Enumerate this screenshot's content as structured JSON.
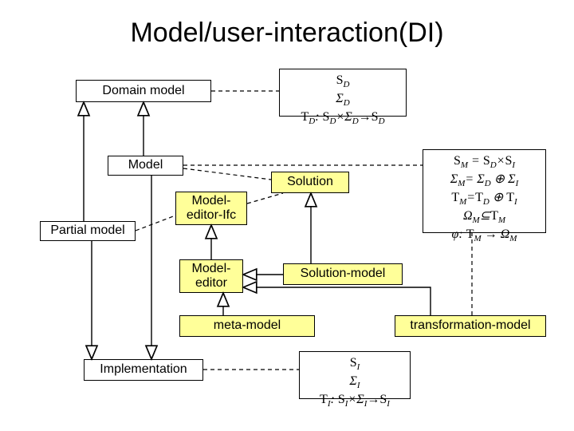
{
  "title": "Model/user-interaction(DI)",
  "boxes": {
    "domain_model": "Domain model",
    "model": "Model",
    "partial_model": "Partial model",
    "solution": "Solution",
    "model_editor_ifc": "Model-\neditor-Ifc",
    "model_editor": "Model-\neditor",
    "solution_model": "Solution-model",
    "meta_model": "meta-model",
    "transformation_model": "transformation-model",
    "implementation": "Implementation"
  },
  "math": {
    "domain": {
      "line1": "S_D",
      "line2": "Σ_D",
      "line3": "T_D: S_D × Σ_D → S_D"
    },
    "model_sm": {
      "line1": "S_M = S_D × S_I",
      "line2": "Σ_M = Σ_D ⊕ Σ_I",
      "line3": "T_M = T_D ⊕ T_I",
      "line4": "Ω_M ⊆ T_M",
      "line5": "φ: T_M → Ω_M"
    },
    "impl": {
      "line1": "S_I",
      "line2": "Σ_I",
      "line3": "T_I: S_I × Σ_I → S_I"
    }
  },
  "chart_data": {
    "type": "diagram",
    "title": "Model/user-interaction(DI)",
    "nodes": [
      {
        "id": "domain_model",
        "label": "Domain model",
        "kind": "class"
      },
      {
        "id": "model",
        "label": "Model",
        "kind": "class"
      },
      {
        "id": "partial_model",
        "label": "Partial model",
        "kind": "class"
      },
      {
        "id": "solution",
        "label": "Solution",
        "kind": "class-yellow"
      },
      {
        "id": "model_editor_ifc",
        "label": "Model-editor-Ifc",
        "kind": "class-yellow"
      },
      {
        "id": "model_editor",
        "label": "Model-editor",
        "kind": "class-yellow"
      },
      {
        "id": "solution_model",
        "label": "Solution-model",
        "kind": "class-yellow"
      },
      {
        "id": "meta_model",
        "label": "meta-model",
        "kind": "class-yellow"
      },
      {
        "id": "transformation_model",
        "label": "transformation-model",
        "kind": "class-yellow"
      },
      {
        "id": "implementation",
        "label": "Implementation",
        "kind": "class"
      },
      {
        "id": "math_domain",
        "label": "S_D; Σ_D; T_D: S_D×Σ_D→S_D",
        "kind": "note"
      },
      {
        "id": "math_model",
        "label": "S_M=S_D×S_I; Σ_M=Σ_D⊕Σ_I; T_M=T_D⊕T_I; Ω_M⊆T_M; φ:T_M→Ω_M",
        "kind": "note"
      },
      {
        "id": "math_impl",
        "label": "S_I; Σ_I; T_I: S_I×Σ_I→S_I",
        "kind": "note"
      }
    ],
    "edges": [
      {
        "from": "model",
        "to": "domain_model",
        "type": "generalization"
      },
      {
        "from": "partial_model",
        "to": "domain_model",
        "type": "generalization"
      },
      {
        "from": "model",
        "to": "implementation",
        "type": "generalization"
      },
      {
        "from": "partial_model",
        "to": "implementation",
        "type": "generalization"
      },
      {
        "from": "model_editor",
        "to": "model_editor_ifc",
        "type": "generalization"
      },
      {
        "from": "solution_model",
        "to": "solution",
        "type": "generalization"
      },
      {
        "from": "solution_model",
        "to": "model_editor",
        "type": "generalization"
      },
      {
        "from": "meta_model",
        "to": "model_editor",
        "type": "generalization"
      },
      {
        "from": "transformation_model",
        "to": "model_editor",
        "type": "generalization"
      },
      {
        "from": "domain_model",
        "to": "math_domain",
        "type": "note-anchor"
      },
      {
        "from": "model",
        "to": "math_model",
        "type": "note-anchor"
      },
      {
        "from": "model",
        "to": "solution",
        "type": "note-anchor"
      },
      {
        "from": "model_editor_ifc",
        "to": "solution",
        "type": "note-anchor"
      },
      {
        "from": "partial_model",
        "to": "model_editor_ifc",
        "type": "note-anchor"
      },
      {
        "from": "implementation",
        "to": "math_impl",
        "type": "note-anchor"
      },
      {
        "from": "transformation_model",
        "to": "math_model",
        "type": "note-anchor"
      }
    ]
  }
}
